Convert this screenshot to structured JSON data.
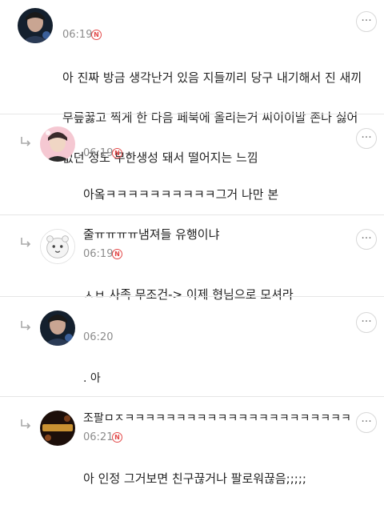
{
  "comments": [
    {
      "time": "06:19",
      "new_badge": "N",
      "lines": [
        "아 진짜 방금 생각난거 있음 지들끼리 당구 내기해서 진 새끼",
        "무릎꿇고 찍게 한 다음 페북에 올리는거 씨이이발 존나 싫어",
        "없던 정도 무한생성 돼서 떨어지는 느낌"
      ],
      "avatar": "male-dark-stage-avatar",
      "reply": false
    },
    {
      "time": "06:19",
      "new_badge": "N",
      "lines": [
        "아옼ㅋㅋㅋㅋㅋㅋㅋㅋㅋㅋ그거 나만 본",
        "줄ㅠㅠㅠㅠ냄져들 유행이냐"
      ],
      "avatar": "pink-idol-avatar",
      "reply": true
    },
    {
      "time": "06:19",
      "new_badge": "N",
      "lines": [
        "ㅅㅂ 사족 무조건-> 이제 형님으로 모셔라"
      ],
      "avatar": "cute-bear-avatar",
      "reply": true
    },
    {
      "time": "06:20",
      "new_badge": "N",
      "lines": [
        "          .  아",
        "조팔ㅁㅈㅋㅋㅋㅋㅋㅋㅋㅋㅋㅋㅋㅋㅋㅋㅋㅋㅋㅋㅋㅋㅋㅋ"
      ],
      "avatar": "male-dark-stage-avatar",
      "reply": true
    },
    {
      "time": "06:21",
      "new_badge": "N",
      "lines": [
        "아 인정 그거보면 친구끊거나 팔로워끊음;;;;;"
      ],
      "avatar": "neon-sign-avatar",
      "reply": true
    }
  ],
  "more_label": "···",
  "colors": {
    "badge": "#e34a4a",
    "meta": "#8c8c8c",
    "divider": "#e6e6e6"
  }
}
